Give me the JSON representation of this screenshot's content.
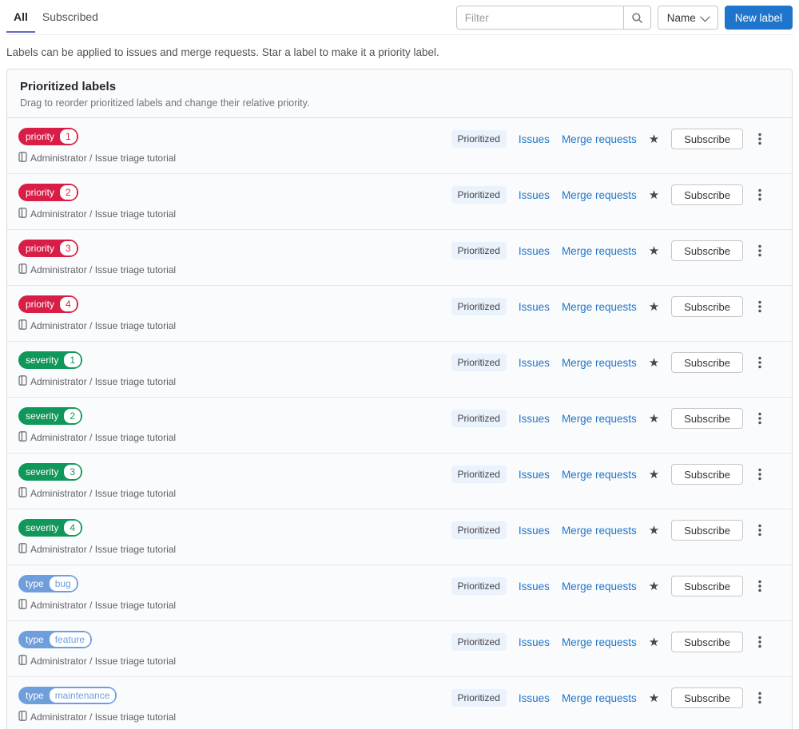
{
  "tabs": [
    {
      "label": "All",
      "active": true
    },
    {
      "label": "Subscribed",
      "active": false
    }
  ],
  "toolbar": {
    "filter_placeholder": "Filter",
    "search_icon": "magnifier",
    "sort_label": "Name",
    "new_label": "New label"
  },
  "page_description": "Labels can be applied to issues and merge requests. Star a label to make it a priority label.",
  "card": {
    "title": "Prioritized labels",
    "subtitle": "Drag to reorder prioritized labels and change their relative priority."
  },
  "project": "Administrator / Issue triage tutorial",
  "row_actions": {
    "prioritized": "Prioritized",
    "issues": "Issues",
    "merge_requests": "Merge requests",
    "star_icon": "star",
    "subscribe": "Subscribe",
    "more_icon": "vertical-ellipsis"
  },
  "labels": [
    {
      "scope": "priority",
      "value": "1",
      "color": "#d81e46"
    },
    {
      "scope": "priority",
      "value": "2",
      "color": "#d81e46"
    },
    {
      "scope": "priority",
      "value": "3",
      "color": "#d81e46"
    },
    {
      "scope": "priority",
      "value": "4",
      "color": "#d81e46"
    },
    {
      "scope": "severity",
      "value": "1",
      "color": "#10975a"
    },
    {
      "scope": "severity",
      "value": "2",
      "color": "#10975a"
    },
    {
      "scope": "severity",
      "value": "3",
      "color": "#10975a"
    },
    {
      "scope": "severity",
      "value": "4",
      "color": "#10975a"
    },
    {
      "scope": "type",
      "value": "bug",
      "color": "#6e9fdc"
    },
    {
      "scope": "type",
      "value": "feature",
      "color": "#6e9fdc"
    },
    {
      "scope": "type",
      "value": "maintenance",
      "color": "#6e9fdc"
    }
  ],
  "colors": {
    "primary_button": "#1f75cb",
    "link": "#1f75cb",
    "active_tab_indicator": "#6666c4",
    "prioritized_badge_bg": "#eaf2fc"
  }
}
